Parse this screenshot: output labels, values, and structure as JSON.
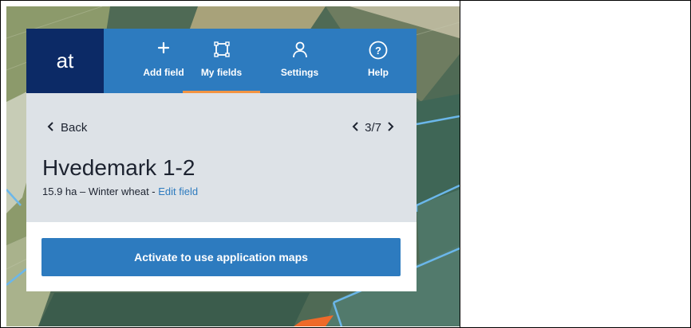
{
  "logo": {
    "text": "at"
  },
  "nav": {
    "items": [
      {
        "label": "Add field",
        "icon": "plus-icon"
      },
      {
        "label": "My fields",
        "icon": "field-square-icon",
        "active": true
      },
      {
        "label": "Settings",
        "icon": "user-icon"
      },
      {
        "label": "Help",
        "icon": "help-circle-icon"
      }
    ]
  },
  "field": {
    "back_label": "Back",
    "pager": "3/7",
    "name": "Hvedemark 1-2",
    "summary": "15.9 ha – Winter wheat - ",
    "edit_link": "Edit field"
  },
  "action": {
    "button_label": "Activate to use application maps"
  },
  "colors": {
    "nav_blue": "#2d7bbf",
    "logo_navy": "#0c2a66",
    "active_underline": "#f39442",
    "panel_gray": "#dde2e7"
  }
}
